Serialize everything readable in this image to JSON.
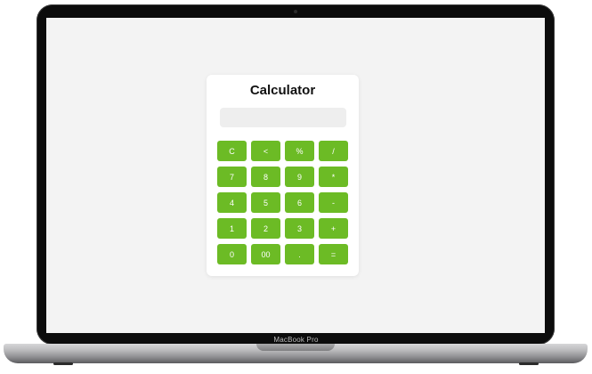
{
  "device": {
    "brand_label": "MacBook Pro"
  },
  "calculator": {
    "title": "Calculator",
    "display_value": "",
    "accent_color": "#6cbb25",
    "keys": [
      [
        "C",
        "<",
        "%",
        "/"
      ],
      [
        "7",
        "8",
        "9",
        "*"
      ],
      [
        "4",
        "5",
        "6",
        "-"
      ],
      [
        "1",
        "2",
        "3",
        "+"
      ],
      [
        "0",
        "00",
        ".",
        "="
      ]
    ]
  }
}
